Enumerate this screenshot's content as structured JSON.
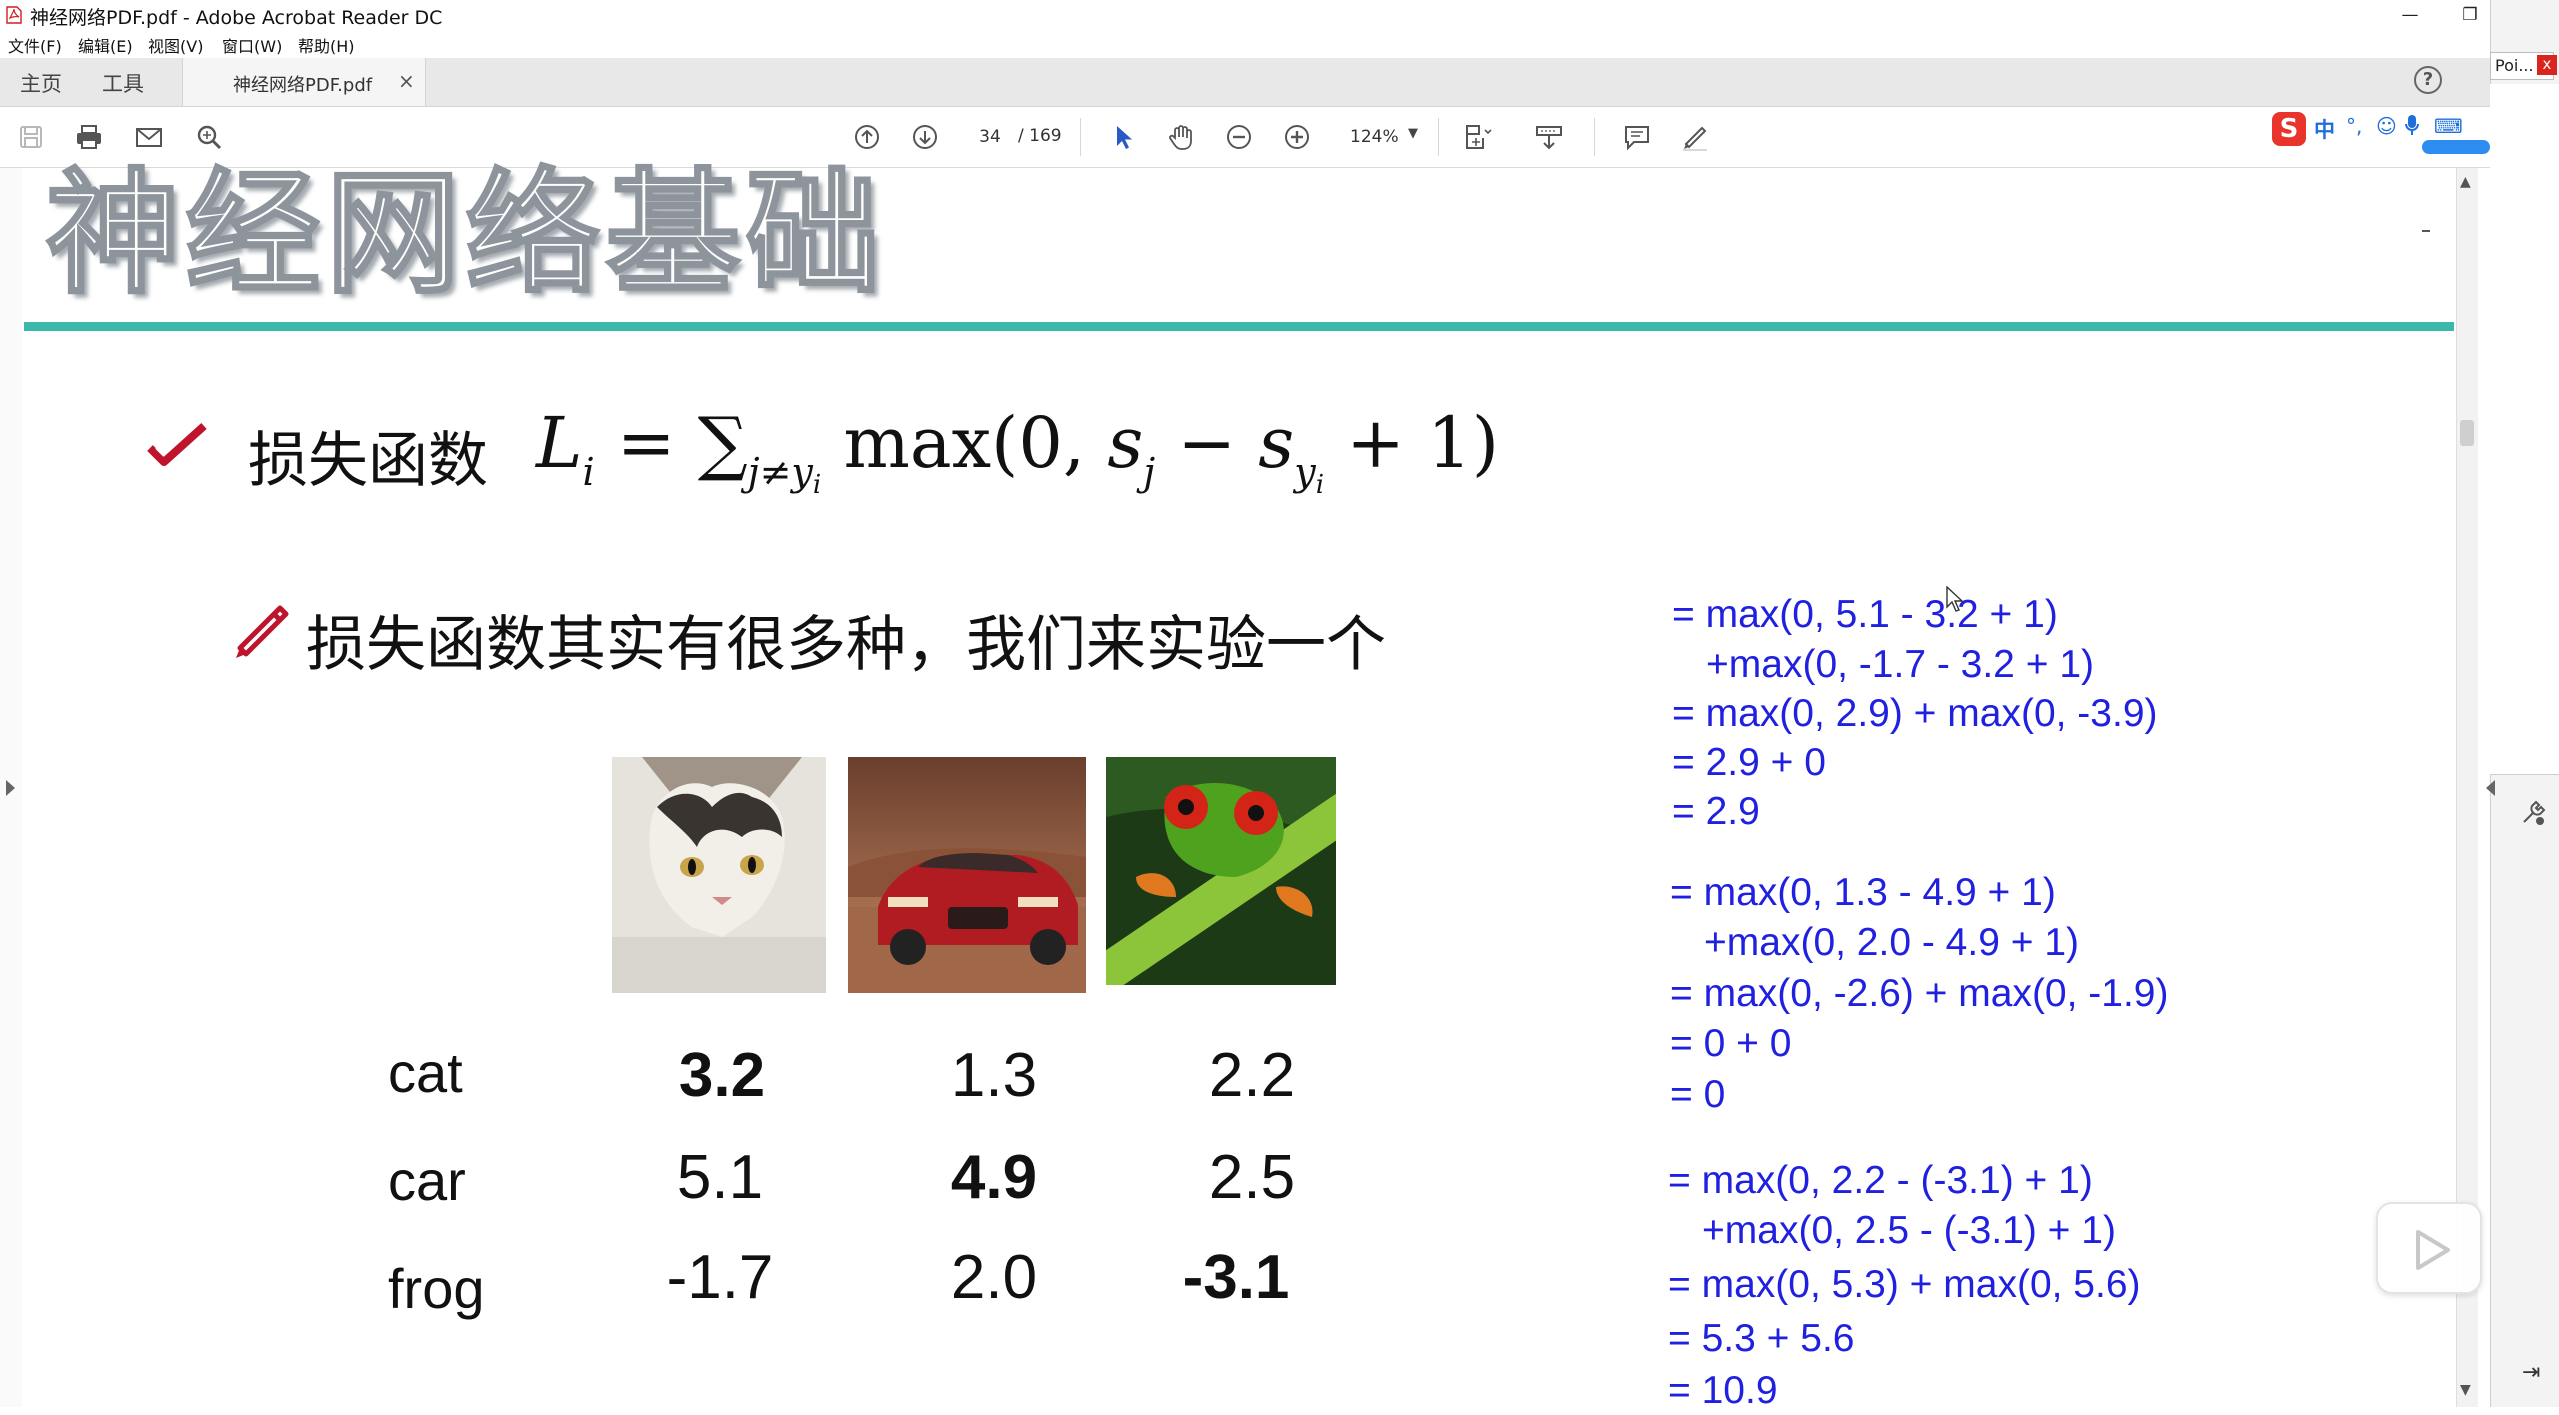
{
  "window": {
    "title": "神经网络PDF.pdf - Adobe Acrobat Reader DC",
    "controls": [
      "minimize",
      "restore",
      "close"
    ]
  },
  "menu": [
    "文件(F)",
    "编辑(E)",
    "视图(V)",
    "窗口(W)",
    "帮助(H)"
  ],
  "tabs": {
    "home": "主页",
    "tools": "工具",
    "document": "神经网络PDF.pdf",
    "close_glyph": "×",
    "help_glyph": "?"
  },
  "toolbar": {
    "current_page": "34",
    "total_pages": "/ 169",
    "zoom": "124%",
    "icons": [
      "save-icon",
      "print-icon",
      "email-icon",
      "search-icon",
      "page-up-icon",
      "page-down-icon",
      "select-arrow-icon",
      "hand-icon",
      "zoom-out-icon",
      "zoom-in-icon",
      "fit-page-icon",
      "scroll-mode-icon",
      "comment-icon",
      "highlight-pen-icon"
    ]
  },
  "ime": {
    "logo": "S",
    "mode": "中",
    "punct": "°,",
    "emoji": "☺",
    "mic": "🎤",
    "keyboard": "⌨"
  },
  "side_pane": {
    "tab_label": "Poi...",
    "close_glyph": "x"
  },
  "slide": {
    "title": "神经网络基础",
    "loss_label": "损失函数",
    "subheading": "损失函数其实有很多种，我们来实验一个",
    "images": [
      "cat",
      "car",
      "frog"
    ],
    "score_table": {
      "rows": [
        {
          "label": "cat",
          "values": [
            "3.2",
            "1.3",
            "2.2"
          ],
          "bold_index": 0
        },
        {
          "label": "car",
          "values": [
            "5.1",
            "4.9",
            "2.5"
          ],
          "bold_index": 1
        },
        {
          "label": "frog",
          "values": [
            "-1.7",
            "2.0",
            "-3.1"
          ],
          "bold_index": 2
        }
      ]
    },
    "calculations": [
      [
        "= max(0, 5.1 - 3.2 + 1)",
        "+max(0, -1.7 - 3.2 + 1)",
        "= max(0, 2.9) + max(0, -3.9)",
        "= 2.9 + 0",
        "= 2.9"
      ],
      [
        "= max(0, 1.3 - 4.9 + 1)",
        "+max(0, 2.0 - 4.9 + 1)",
        "= max(0, -2.6) + max(0, -1.9)",
        "= 0 + 0",
        "= 0"
      ],
      [
        "= max(0, 2.2 - (-3.1) + 1)",
        "+max(0, 2.5 - (-3.1) + 1)",
        "= max(0, 5.3) + max(0, 5.6)",
        "= 5.3 + 5.6",
        "= 10.9"
      ]
    ]
  },
  "colors": {
    "teal_rule": "#3cb8aa",
    "calc_blue": "#2020e0",
    "check_red": "#c0142c",
    "ime_red": "#e8342b",
    "ime_blue": "#1e6fdc"
  }
}
